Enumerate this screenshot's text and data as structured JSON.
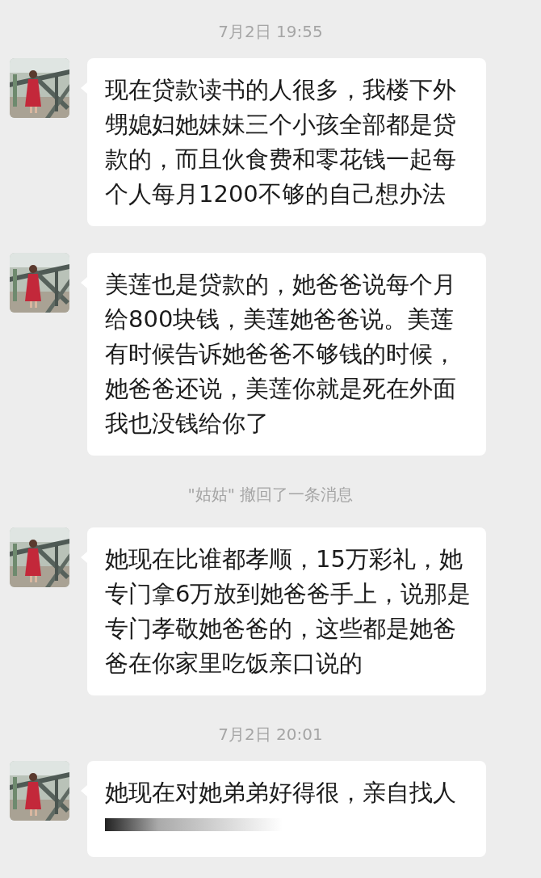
{
  "items": [
    {
      "kind": "time",
      "text": "7月2日 19:55"
    },
    {
      "kind": "message",
      "text": "现在贷款读书的人很多，我楼下外甥媳妇她妹妹三个小孩全部都是贷款的，而且伙食费和零花钱一起每个人每月1200不够的自己想办法",
      "blurred": false
    },
    {
      "kind": "message",
      "text": "美莲也是贷款的，她爸爸说每个月给800块钱，美莲她爸爸说。美莲有时候告诉她爸爸不够钱的时候，她爸爸还说，美莲你就是死在外面我也没钱给你了",
      "blurred": false
    },
    {
      "kind": "recall",
      "text": "\"姑姑\" 撤回了一条消息"
    },
    {
      "kind": "message",
      "text": "她现在比谁都孝顺，15万彩礼，她专门拿6万放到她爸爸手上，说那是专门孝敬她爸爸的，这些都是她爸爸在你家里吃饭亲口说的",
      "blurred": false
    },
    {
      "kind": "time",
      "text": "7月2日 20:01"
    },
    {
      "kind": "message",
      "text": "她现在对她弟弟好得很，亲自找人",
      "blurred": true
    }
  ]
}
